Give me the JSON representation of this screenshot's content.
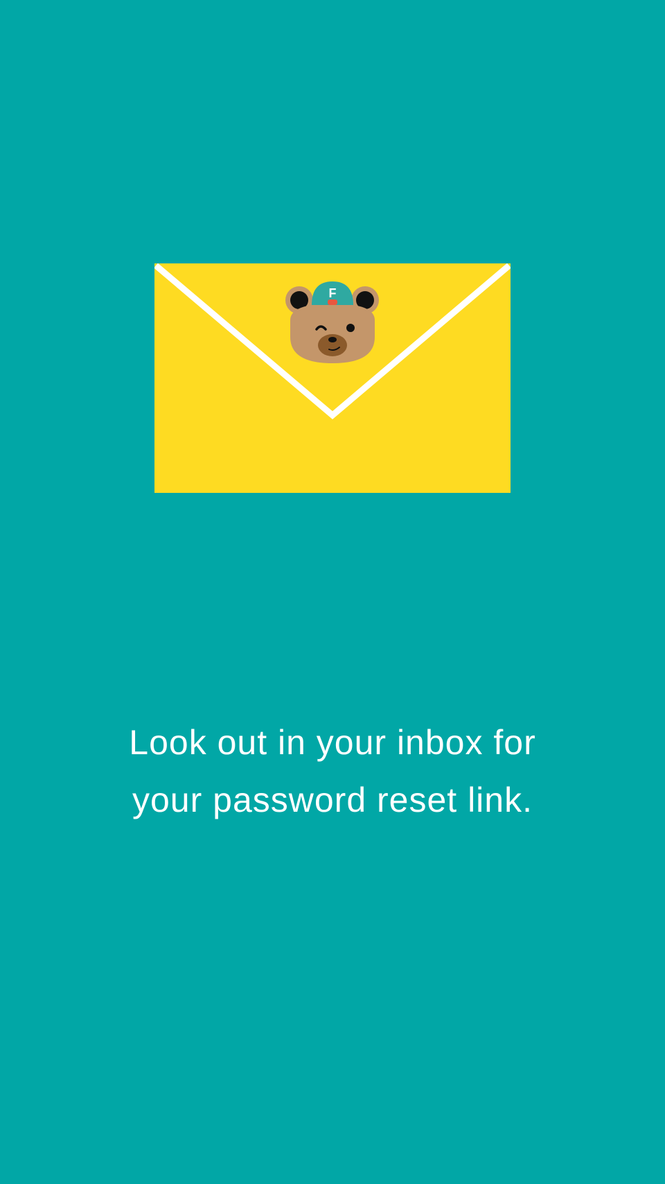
{
  "screen": {
    "background_color": "#01A7A6"
  },
  "envelope": {
    "icon": "envelope-icon",
    "body_color": "#FEDB22",
    "flap_line_color": "#FFFFFF"
  },
  "mascot": {
    "icon": "bear-mascot-icon",
    "cap_letter": "F",
    "fur_color": "#C4966A",
    "cap_color": "#2FA9A1"
  },
  "message": {
    "line1": "Look out in your inbox for",
    "line2": "your password reset link."
  }
}
